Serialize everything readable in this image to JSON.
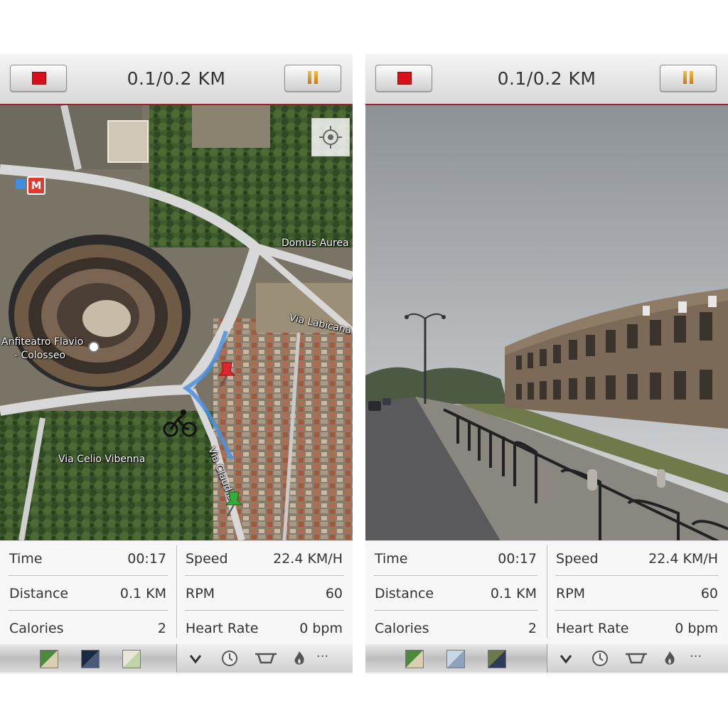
{
  "screens": [
    {
      "header": {
        "stop_label": "stop",
        "pause_label": "pause",
        "distance_progress": "0.1/0.2 KM"
      },
      "view_mode": "satellite-map",
      "map_labels": {
        "place": "Domus Aurea",
        "colosseum_line1": "Anfiteatro Flavio",
        "colosseum_line2": "- Colosseo",
        "road1": "Via Labicana",
        "road2": "Via Celio Vibenna",
        "road3": "Via Claudia",
        "metro": "M"
      },
      "stats": {
        "time_label": "Time",
        "time_value": "00:17",
        "speed_label": "Speed",
        "speed_value": "22.4 KM/H",
        "distance_label": "Distance",
        "distance_value": "0.1 KM",
        "rpm_label": "RPM",
        "rpm_value": "60",
        "calories_label": "Calories",
        "calories_value": "2",
        "heart_label": "Heart Rate",
        "heart_value": "0 bpm"
      },
      "toolbar": {
        "left": [
          "map-view-icon",
          "night-map-icon",
          "street-map-icon"
        ],
        "right": [
          "chevron-down-icon",
          "clock-icon",
          "bike-icon",
          "flame-icon",
          "more-icon"
        ],
        "more_label": "···"
      }
    },
    {
      "header": {
        "stop_label": "stop",
        "pause_label": "pause",
        "distance_progress": "0.1/0.2 KM"
      },
      "view_mode": "street-view",
      "stats": {
        "time_label": "Time",
        "time_value": "00:17",
        "speed_label": "Speed",
        "speed_value": "22.4 KM/H",
        "distance_label": "Distance",
        "distance_value": "0.1 KM",
        "rpm_label": "RPM",
        "rpm_value": "60",
        "calories_label": "Calories",
        "calories_value": "2",
        "heart_label": "Heart Rate",
        "heart_value": "0 bpm"
      },
      "toolbar": {
        "left": [
          "map-view-icon",
          "street-view-icon",
          "satellite-view-icon"
        ],
        "right": [
          "chevron-down-icon",
          "clock-icon",
          "bike-icon",
          "flame-icon",
          "more-icon"
        ],
        "more_label": "···"
      }
    }
  ],
  "colors": {
    "stop": "#d9101a",
    "pause": "#e0a020",
    "accent_line": "#a3202a",
    "route": "#4a90e2"
  }
}
